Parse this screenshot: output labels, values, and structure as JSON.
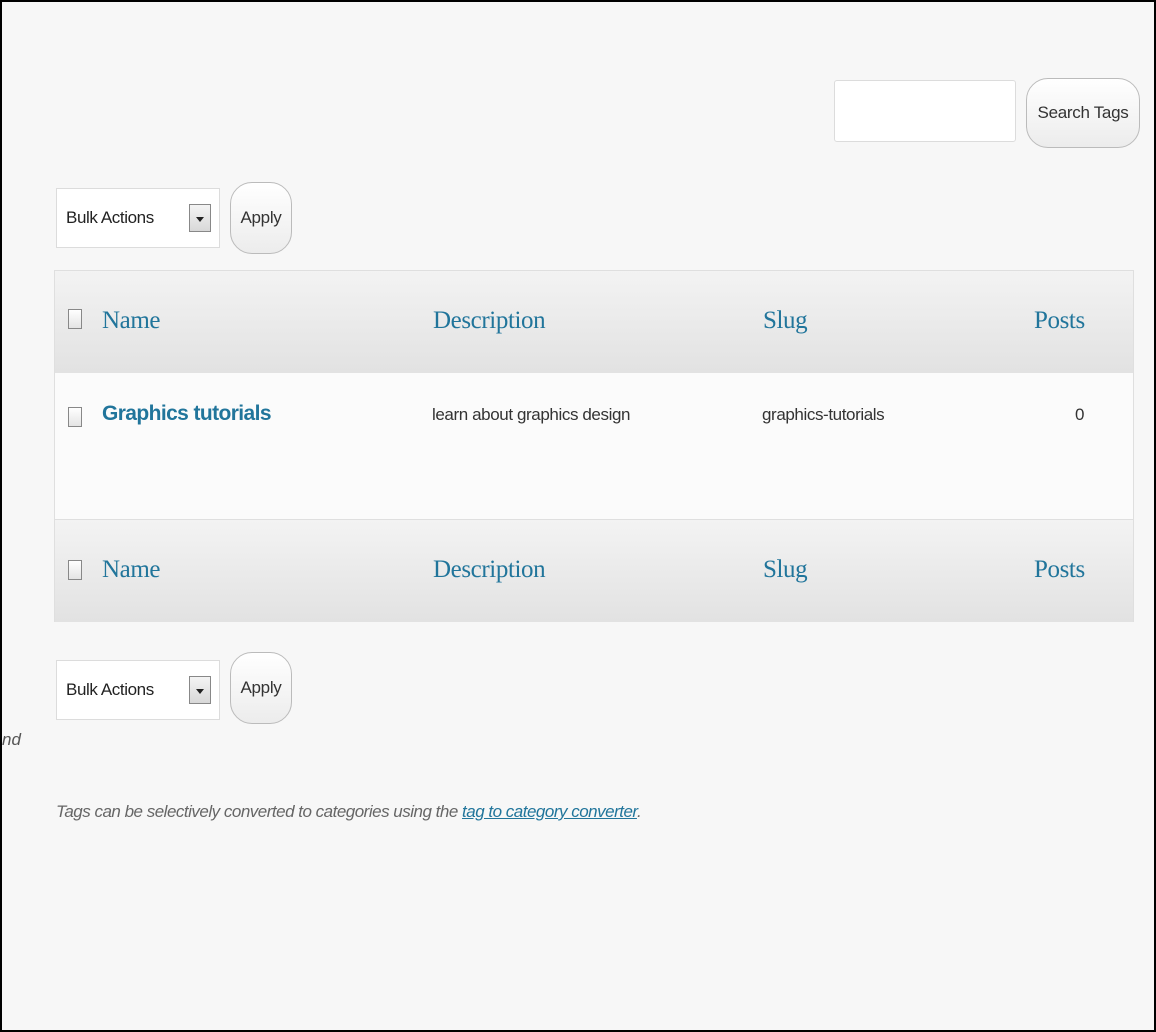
{
  "search": {
    "input_value": "",
    "button_label": "Search Tags"
  },
  "bulk_top": {
    "select_value": "Bulk Actions",
    "apply_label": "Apply"
  },
  "bulk_bottom": {
    "select_value": "Bulk Actions",
    "apply_label": "Apply"
  },
  "table": {
    "columns": {
      "name": "Name",
      "description": "Description",
      "slug": "Slug",
      "posts": "Posts"
    },
    "rows": [
      {
        "name": "Graphics tutorials",
        "description": "learn about graphics design",
        "slug": "graphics-tutorials",
        "posts": "0"
      }
    ]
  },
  "side_fragment": "nd",
  "note": {
    "prefix": "Tags can be selectively converted to categories using the ",
    "link": "tag to category converter",
    "suffix": "."
  },
  "colors": {
    "link": "#21759b",
    "background": "#f7f7f7"
  }
}
